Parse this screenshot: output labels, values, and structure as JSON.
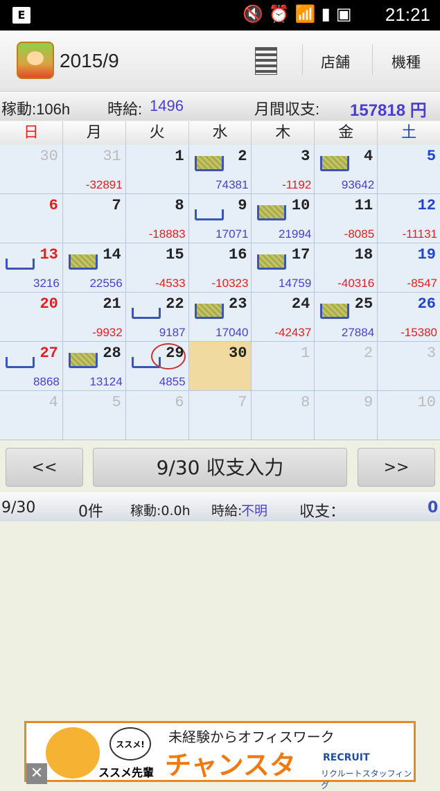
{
  "status_bar": {
    "time": "21:21",
    "left_icon": "E"
  },
  "app_bar": {
    "title": "2015/9",
    "store_label": "店舗",
    "model_label": "機種"
  },
  "summary": {
    "hours_label": "稼動:106h",
    "wage_label": "時給:",
    "wage_value": "1496",
    "monthly_label": "月間収支:",
    "monthly_value": "157818 円"
  },
  "weekdays": [
    "日",
    "月",
    "火",
    "水",
    "木",
    "金",
    "土"
  ],
  "weeks": [
    [
      {
        "day": "30",
        "dim": true
      },
      {
        "day": "31",
        "dim": true,
        "value": "-32891",
        "neg": true
      },
      {
        "day": "1"
      },
      {
        "day": "2",
        "box": "full",
        "value": "74381"
      },
      {
        "day": "3",
        "value": "-1192",
        "neg": true
      },
      {
        "day": "4",
        "box": "full",
        "value": "93642"
      },
      {
        "day": "5"
      }
    ],
    [
      {
        "day": "6"
      },
      {
        "day": "7"
      },
      {
        "day": "8",
        "value": "-18883",
        "neg": true
      },
      {
        "day": "9",
        "box": "empty",
        "value": "17071"
      },
      {
        "day": "10",
        "box": "full",
        "value": "21994"
      },
      {
        "day": "11",
        "value": "-8085",
        "neg": true
      },
      {
        "day": "12",
        "value": "-11131",
        "neg": true
      }
    ],
    [
      {
        "day": "13",
        "box": "empty",
        "value": "3216"
      },
      {
        "day": "14",
        "box": "full",
        "value": "22556"
      },
      {
        "day": "15",
        "value": "-4533",
        "neg": true
      },
      {
        "day": "16",
        "value": "-10323",
        "neg": true
      },
      {
        "day": "17",
        "box": "full",
        "value": "14759"
      },
      {
        "day": "18",
        "value": "-40316",
        "neg": true
      },
      {
        "day": "19",
        "value": "-8547",
        "neg": true
      }
    ],
    [
      {
        "day": "20"
      },
      {
        "day": "21",
        "value": "-9932",
        "neg": true
      },
      {
        "day": "22",
        "box": "empty",
        "value": "9187"
      },
      {
        "day": "23",
        "box": "full",
        "value": "17040"
      },
      {
        "day": "24",
        "value": "-42437",
        "neg": true
      },
      {
        "day": "25",
        "box": "full",
        "value": "27884"
      },
      {
        "day": "26",
        "value": "-15380",
        "neg": true
      }
    ],
    [
      {
        "day": "27",
        "box": "empty",
        "value": "8868"
      },
      {
        "day": "28",
        "box": "full",
        "value": "13124"
      },
      {
        "day": "29",
        "box": "empty",
        "value": "4855",
        "circle": true
      },
      {
        "day": "30",
        "today": true
      },
      {
        "day": "1",
        "dim": true
      },
      {
        "day": "2",
        "dim": true
      },
      {
        "day": "3",
        "dim": true
      }
    ],
    [
      {
        "day": "4",
        "dim": true
      },
      {
        "day": "5",
        "dim": true
      },
      {
        "day": "6",
        "dim": true
      },
      {
        "day": "7",
        "dim": true
      },
      {
        "day": "8",
        "dim": true
      },
      {
        "day": "9",
        "dim": true
      },
      {
        "day": "10",
        "dim": true
      }
    ]
  ],
  "nav": {
    "prev_label": "<<",
    "input_label": "9/30 収支入力",
    "next_label": ">>"
  },
  "day_summary": {
    "date": "9/30",
    "count": "0件",
    "hours": "稼動:0.0h",
    "wage_label": "時給:",
    "wage_value": "不明",
    "balance_label": "収支：",
    "balance_value": "0"
  },
  "ad": {
    "bubble": "ススメ!",
    "mascot_label": "ススメ先輩",
    "line1": "未経験からオフィスワーク",
    "line2": "チャンスタ",
    "logo": "RECRUIT",
    "logo_sub": "リクルートスタッフィング",
    "close": "✕"
  }
}
